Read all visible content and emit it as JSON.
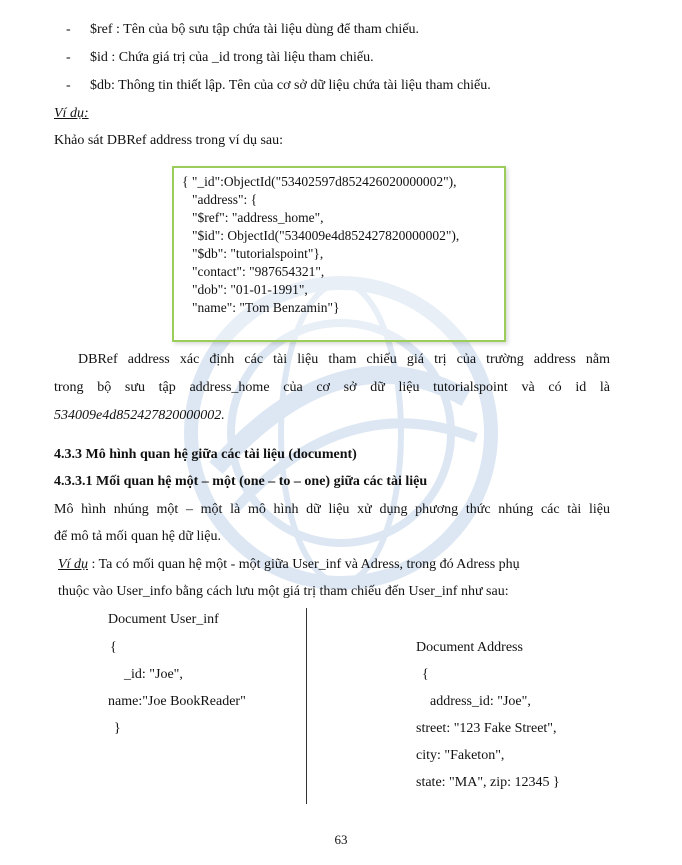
{
  "bullets": [
    {
      "dash": "-",
      "text": "$ref : Tên của bộ sưu tập chứa tài liệu dùng để tham chiếu."
    },
    {
      "dash": "-",
      "text": "$id : Chứa giá trị của _id trong tài liệu tham chiếu."
    },
    {
      "dash": "-",
      "text": "$db: Thông tin thiết lập. Tên của cơ sở dữ liệu chứa tài liệu tham chiếu."
    }
  ],
  "example1": {
    "label": "Ví dụ:",
    "intro": "Khảo sát DBRef address trong ví dụ sau:"
  },
  "code": [
    "{  \"_id\":ObjectId(\"53402597d852426020000002\"),",
    "\"address\": {",
    "\"$ref\": \"address_home\",",
    "\"$id\": ObjectId(\"534009e4d852427820000002\"),",
    "\"$db\": \"tutorialspoint\"},",
    "\"contact\": \"987654321\",",
    "\"dob\": \"01-01-1991\",",
    "\"name\": \"Tom Benzamin\"}"
  ],
  "explain": {
    "line1": "DBRef address xác định các tài liệu tham chiếu giá trị của trường address  nằm",
    "line2": "trong bộ sưu tập address_home của cơ sở dữ liệu tutorialspoint và có id là",
    "line3": "534009e4d852427820000002."
  },
  "heading1": "4.3.3 Mô hình quan hệ giữa các tài liệu (document)",
  "heading2": "4.3.3.1 Mối quan hệ một – một (one – to – one)  giữa các tài liệu",
  "para1": {
    "line1": "Mô hình nhúng một – một là mô hình dữ liệu xử dụng phương thức nhúng các tài liệu",
    "line2": "để mô tả mối quan hệ dữ liệu."
  },
  "example2": {
    "label": "Ví dụ",
    "line1_rest": " :  Ta có mối quan hệ một  - một  giữa  User_inf và Adress, trong đó Adress phụ",
    "line2": "thuộc vào User_info bằng cách lưu một giá trị tham chiếu đến  User_inf như sau:"
  },
  "left_doc": [
    "Document User_inf",
    "{",
    "_id: \"Joe\",",
    "name:\"Joe BookReader\"",
    "}"
  ],
  "right_doc": [
    "Document Address",
    "{",
    "address_id: \"Joe\",",
    "street: \"123 Fake Street\",",
    "city: \"Faketon\",",
    "state:  \"MA\",  zip:  12345  }"
  ],
  "page_number": "63"
}
